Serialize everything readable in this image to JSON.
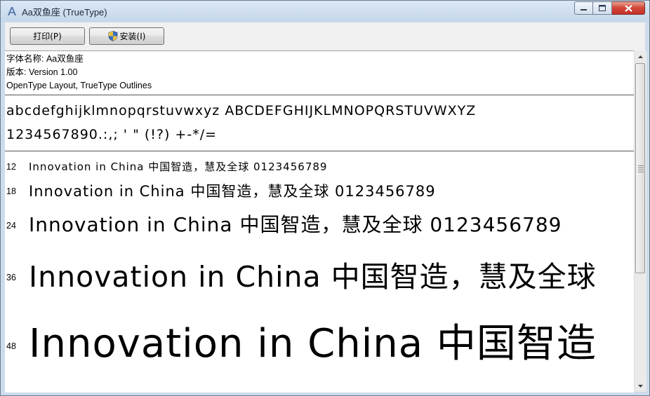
{
  "window": {
    "title": "Aa双鱼座 (TrueType)",
    "title_icon": "font-file-icon"
  },
  "toolbar": {
    "print_label": "打印(P)",
    "install_label": "安装(I)"
  },
  "info": {
    "font_name": "字体名称: Aa双鱼座",
    "version": "版本: Version 1.00",
    "type": "OpenType Layout, TrueType Outlines"
  },
  "charset": {
    "line1": "abcdefghijklmnopqrstuvwxyz ABCDEFGHIJKLMNOPQRSTUVWXYZ",
    "line2": "1234567890.:,; ' \" (!?) +-*/="
  },
  "samples": [
    {
      "size": "12",
      "text": "Innovation in China 中国智造，慧及全球 0123456789"
    },
    {
      "size": "18",
      "text": "Innovation in China 中国智造，慧及全球 0123456789"
    },
    {
      "size": "24",
      "text": "Innovation in China 中国智造，慧及全球 0123456789"
    },
    {
      "size": "36",
      "text": "Innovation in China 中国智造，慧及全球"
    },
    {
      "size": "48",
      "text": "Innovation in China 中国智造"
    }
  ]
}
